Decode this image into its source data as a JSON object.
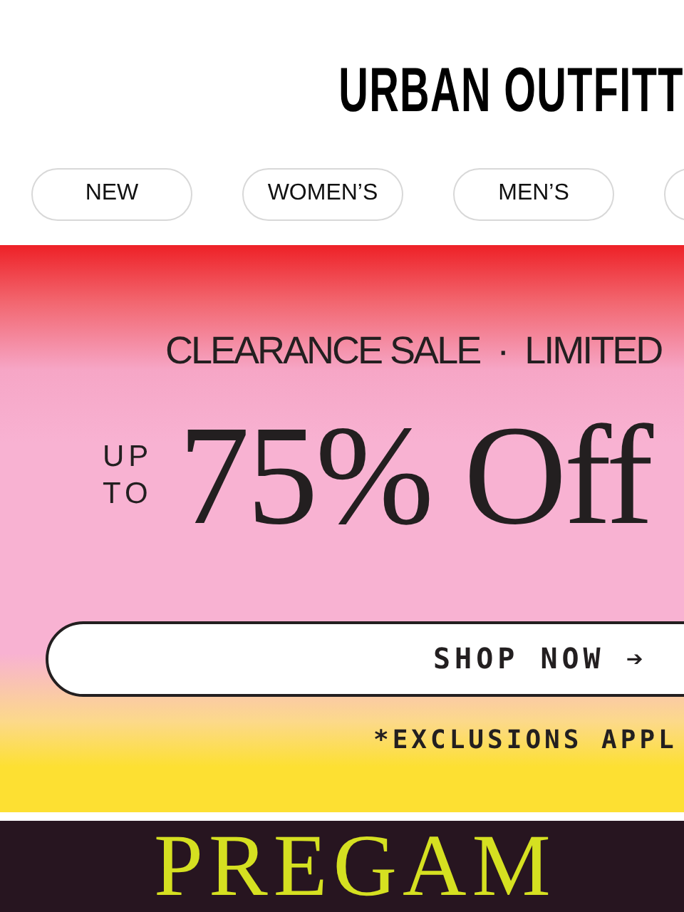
{
  "header": {
    "logo": "URBAN OUTFITT"
  },
  "nav": {
    "items": [
      {
        "label": "NEW"
      },
      {
        "label": "WOMEN’S"
      },
      {
        "label": "MEN’S"
      }
    ],
    "more_cut_off": true
  },
  "promo": {
    "eyebrow": "CLEARANCE SALE  ·  LIMITED",
    "prefix": [
      "UP",
      "TO"
    ],
    "headline": "75% Off",
    "button": "SHOP NOW ➔",
    "note": "*EXCLUSIONS APPL"
  },
  "next_banner": {
    "headline": "PREGAM"
  }
}
